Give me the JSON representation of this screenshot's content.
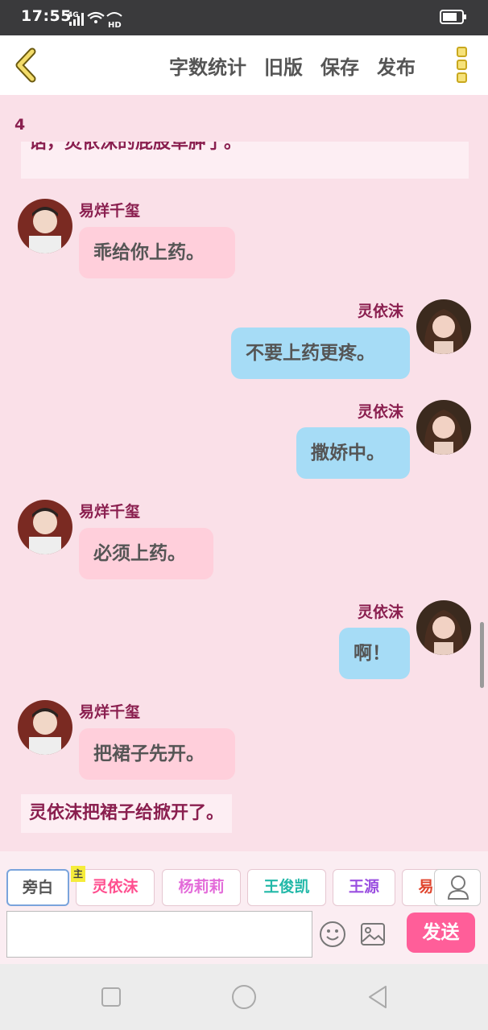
{
  "status_bar": {
    "time": "17:55",
    "network": "4G",
    "hd": "HD"
  },
  "toolbar": {
    "word_count": "字数统计",
    "old_version": "旧版",
    "save": "保存",
    "publish": "发布"
  },
  "chat": {
    "page_number": "4",
    "top_narration": "话，灵依沫的屁股草肿了。",
    "messages": [
      {
        "speaker": "易烊千玺",
        "side": "left",
        "text": "乖给你上药。"
      },
      {
        "speaker": "灵依沫",
        "side": "right",
        "text": "不要上药更疼。"
      },
      {
        "speaker": "灵依沫",
        "side": "right",
        "text": "撒娇中。"
      },
      {
        "speaker": "易烊千玺",
        "side": "left",
        "text": "必须上药。"
      },
      {
        "speaker": "灵依沫",
        "side": "right",
        "text": "啊！"
      },
      {
        "speaker": "易烊千玺",
        "side": "left",
        "text": "把裙子先开。"
      }
    ],
    "bottom_narration": "灵依沫把裙子给掀开了。"
  },
  "characters": [
    {
      "label": "旁白",
      "color": "#555555"
    },
    {
      "label": "灵依沫",
      "color": "#ff4f8f",
      "badge": "主"
    },
    {
      "label": "杨莉莉",
      "color": "#e36bd9"
    },
    {
      "label": "王俊凯",
      "color": "#22b8a8"
    },
    {
      "label": "王源",
      "color": "#9a4fe0"
    },
    {
      "label": "易",
      "color": "#e0452e"
    }
  ],
  "composer": {
    "message_value": "",
    "send_label": "发送"
  }
}
